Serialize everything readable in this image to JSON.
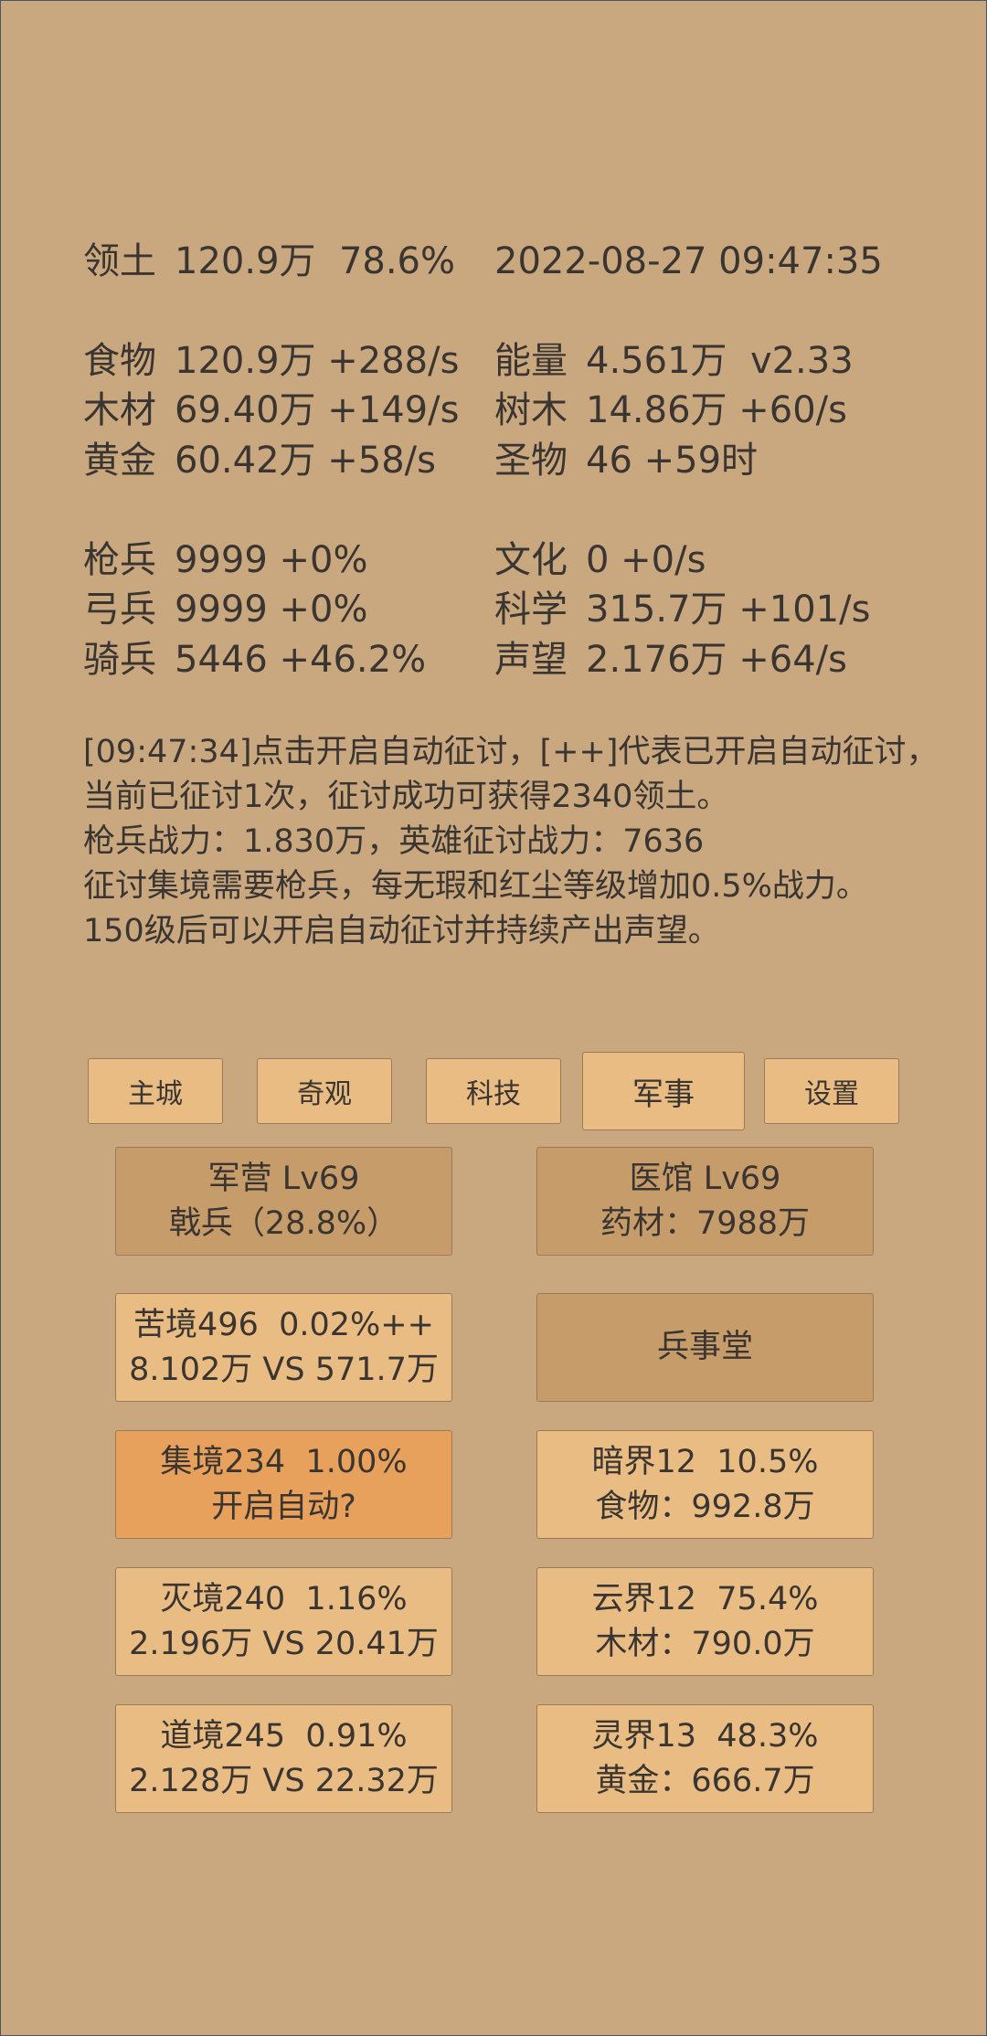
{
  "stats": {
    "territory": {
      "label": "领土",
      "value": "120.9万  78.6%"
    },
    "datetime": "2022-08-27 09:47:35",
    "food": {
      "label": "食物",
      "value": "120.9万 +288/s"
    },
    "energy": {
      "label": "能量",
      "value": "4.561万  v2.33"
    },
    "wood": {
      "label": "木材",
      "value": "69.40万 +149/s"
    },
    "trees": {
      "label": "树木",
      "value": "14.86万 +60/s"
    },
    "gold": {
      "label": "黄金",
      "value": "60.42万 +58/s"
    },
    "relics": {
      "label": "圣物",
      "value": "46 +59时"
    },
    "spearmen": {
      "label": "枪兵",
      "value": "9999 +0%"
    },
    "culture": {
      "label": "文化",
      "value": "0 +0/s"
    },
    "archers": {
      "label": "弓兵",
      "value": "9999 +0%"
    },
    "science": {
      "label": "科学",
      "value": "315.7万 +101/s"
    },
    "cavalry": {
      "label": "骑兵",
      "value": "5446 +46.2%"
    },
    "prestige": {
      "label": "声望",
      "value": "2.176万 +64/s"
    }
  },
  "log": [
    "[09:47:34]点击开启自动征讨，[++]代表已开启自动征讨，",
    "当前已征讨1次，征讨成功可获得2340领土。",
    "枪兵战力：1.830万，英雄征讨战力：7636",
    "征讨集境需要枪兵，每无瑕和红尘等级增加0.5%战力。",
    "150级后可以开启自动征讨并持续产出声望。"
  ],
  "tabs": [
    "主城",
    "奇观",
    "科技",
    "军事",
    "设置"
  ],
  "active_tab": "军事",
  "cards": {
    "barracks": {
      "line1": "军营 Lv69",
      "line2": "戟兵（28.8%）"
    },
    "hospital": {
      "line1": "医馆 Lv69",
      "line2": "药材：7988万"
    },
    "kujing": {
      "line1": "苦境496  0.02%++",
      "line2": "8.102万 VS 571.7万"
    },
    "military_hall": {
      "line1": "兵事堂"
    },
    "jijing": {
      "line1": "集境234  1.00%",
      "line2": "开启自动?"
    },
    "anjie": {
      "line1": "暗界12  10.5%",
      "line2": "食物：992.8万"
    },
    "miejing": {
      "line1": "灭境240  1.16%",
      "line2": "2.196万 VS 20.41万"
    },
    "yunjie": {
      "line1": "云界12  75.4%",
      "line2": "木材：790.0万"
    },
    "daojing": {
      "line1": "道境245  0.91%",
      "line2": "2.128万 VS 22.32万"
    },
    "lingjie": {
      "line1": "灵界13  48.3%",
      "line2": "黄金：666.7万"
    }
  },
  "colors": {
    "background": "#c9a880",
    "card_light": "#e9bc84",
    "card_dark": "#c79c6b",
    "card_highlight": "#e8a15c"
  }
}
